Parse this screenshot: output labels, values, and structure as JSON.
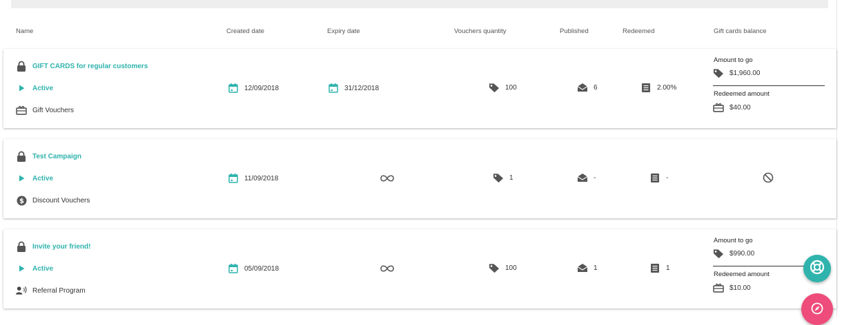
{
  "columns": {
    "name": "Name",
    "created": "Created date",
    "expiry": "Expiry date",
    "quantity": "Vouchers quantity",
    "published": "Published",
    "redeemed": "Redeemed",
    "balance": "Gift cards balance"
  },
  "campaigns": [
    {
      "name": "GIFT CARDS for regular customers",
      "status": "Active",
      "type": "Gift Vouchers",
      "type_icon": "gift-card-icon",
      "created": "12/09/2018",
      "expiry": "31/12/2018",
      "quantity": "100",
      "published": "6",
      "redeemed": "2.00%",
      "balance": {
        "amount_to_go_label": "Amount to go",
        "amount_to_go": "$1,960.00",
        "redeemed_label": "Redeemed amount",
        "redeemed_amount": "$40.00"
      }
    },
    {
      "name": "Test Campaign",
      "status": "Active",
      "type": "Discount Vouchers",
      "type_icon": "dollar-circle-icon",
      "created": "11/09/2018",
      "expiry_icon": "infinity-icon",
      "quantity": "1",
      "published": "-",
      "redeemed": "-",
      "balance_icon": "not-available-icon"
    },
    {
      "name": "Invite your friend!",
      "status": "Active",
      "type": "Referral Program",
      "type_icon": "referral-person-icon",
      "created": "05/09/2018",
      "expiry_icon": "infinity-icon",
      "quantity": "100",
      "published": "1",
      "redeemed": "1",
      "balance": {
        "amount_to_go_label": "Amount to go",
        "amount_to_go": "$990.00",
        "redeemed_label": "Redeemed amount",
        "redeemed_amount": "$10.00"
      }
    }
  ],
  "colors": {
    "accent": "#2fb3ad",
    "help_fab": "#2fb3ad",
    "feedback_fab": "#ee4c7a"
  }
}
